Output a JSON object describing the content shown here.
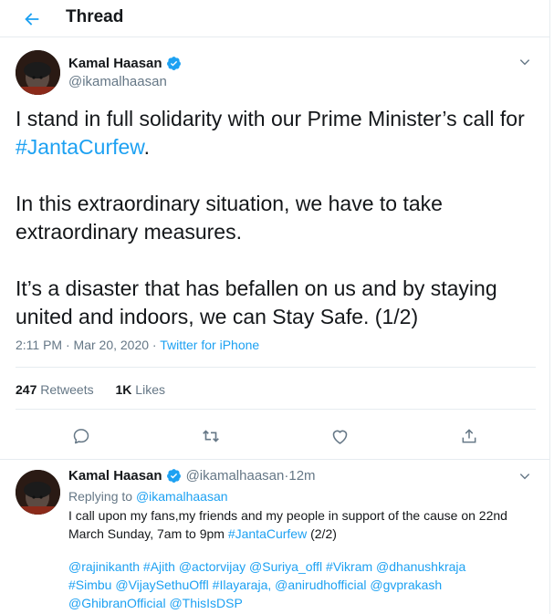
{
  "header": {
    "title": "Thread"
  },
  "colors": {
    "accent": "#1da1f2",
    "text": "#14171a",
    "muted": "#657786",
    "border": "#e6ecf0"
  },
  "main_tweet": {
    "author_name": "Kamal Haasan",
    "handle": "@ikamalhaasan",
    "text_line1": "I stand in full solidarity with our Prime Minister’s call for",
    "hashtag": "#JantaCurfew",
    "hashtag_suffix": ".",
    "paragraph2": "In this extraordinary situation, we have to take extraordinary measures.",
    "paragraph3": "It’s a disaster that has befallen on us and by staying united and indoors, we can Stay Safe. (1/2)",
    "time": "2:11 PM · Mar 20, 2020 · ",
    "source": "Twitter for iPhone",
    "retweets_count": "247",
    "retweets_label": "Retweets",
    "likes_count": "1K",
    "likes_label": "Likes"
  },
  "actions": [
    "reply-icon",
    "retweet-icon",
    "like-icon",
    "share-icon"
  ],
  "reply_tweet": {
    "author_name": "Kamal Haasan",
    "handle": "@ikamalhaasan",
    "time_sep": " · ",
    "time": "12m",
    "replying_label": "Replying to ",
    "replying_to": "@ikamalhaasan",
    "body_part1": "I call upon my fans,my friends and my people in support of the cause on 22nd March Sunday, 7am to 9pm ",
    "body_hashtag": "#JantaCurfew",
    "body_suffix": " (2/2)",
    "mentions_line1": "@rajinikanth #Ajith @actorvijay @Suriya_offl #Vikram @dhanushkraja",
    "mentions_line2": "#Simbu @VijaySethuOffl #Ilayaraja, @anirudhofficial @gvprakash",
    "mentions_line3": "@GhibranOfficial @ThisIsDSP"
  }
}
